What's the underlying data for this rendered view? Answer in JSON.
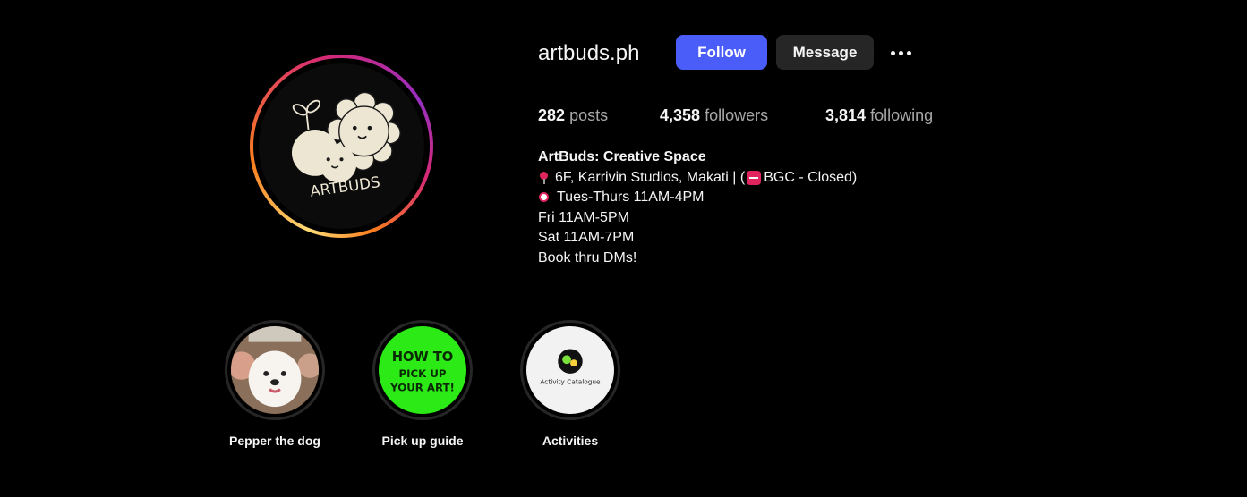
{
  "profile": {
    "username": "artbuds.ph",
    "avatar_icon": "artbuds-logo-icon",
    "avatar_text": "ARTBUDS",
    "story_ring_colors": [
      "#feda75",
      "#fa7e1e",
      "#d62976",
      "#962fbf"
    ]
  },
  "actions": {
    "follow_label": "Follow",
    "message_label": "Message",
    "more_icon": "more-options-icon",
    "follow_color": "#4a5df9",
    "message_color": "#262626"
  },
  "stats": {
    "posts": {
      "count": "282",
      "label": "posts"
    },
    "followers": {
      "count": "4,358",
      "label": "followers"
    },
    "following": {
      "count": "3,814",
      "label": "following"
    }
  },
  "bio": {
    "name": "ArtBuds: Creative Space",
    "location_icon": "pin-icon",
    "location_text_before": "6F, Karrivin Studios, Makati | (",
    "closed_icon": "stop-sign-icon",
    "location_text_after": "BGC - Closed)",
    "hours_icon": "alarm-clock-icon",
    "hours_line1": "Tues-Thurs 11AM-4PM",
    "hours_line2": "Fri 11AM-5PM",
    "hours_line3": "Sat 11AM-7PM",
    "cta": "Book thru DMs!"
  },
  "highlights": [
    {
      "label": "Pepper the dog",
      "icon": "dog-photo-icon"
    },
    {
      "label": "Pick up guide",
      "icon": "pick-up-guide-icon",
      "cover_text": "HOW TO PICK UP YOUR ART!"
    },
    {
      "label": "Activities",
      "icon": "activity-catalogue-icon",
      "cover_text": "Activity Catalogue"
    }
  ]
}
